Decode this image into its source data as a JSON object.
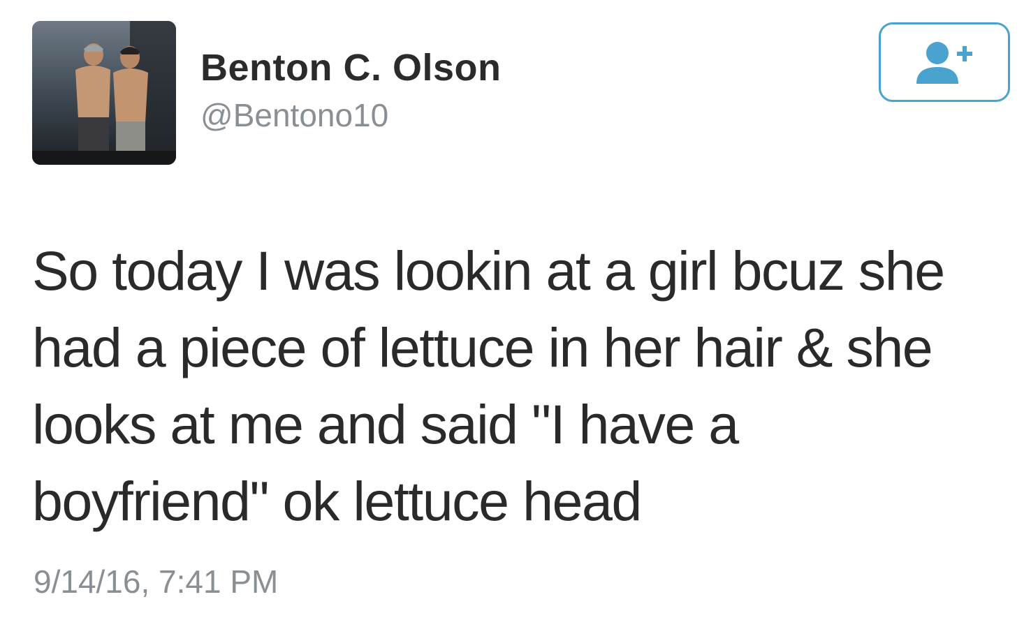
{
  "user": {
    "display_name": "Benton C. Olson",
    "handle": "@Bentono10",
    "avatar_icon": "profile-photo"
  },
  "follow_button": {
    "icon": "add-user-icon",
    "accent_color": "#4aa3cf"
  },
  "tweet": {
    "lines": [
      "So today I was lookin at a girl bcuz she",
      "had a piece of lettuce in her hair & she",
      "looks at me and said \"I have a",
      "boyfriend\" ok lettuce head"
    ],
    "timestamp": "9/14/16, 7:41 PM"
  }
}
